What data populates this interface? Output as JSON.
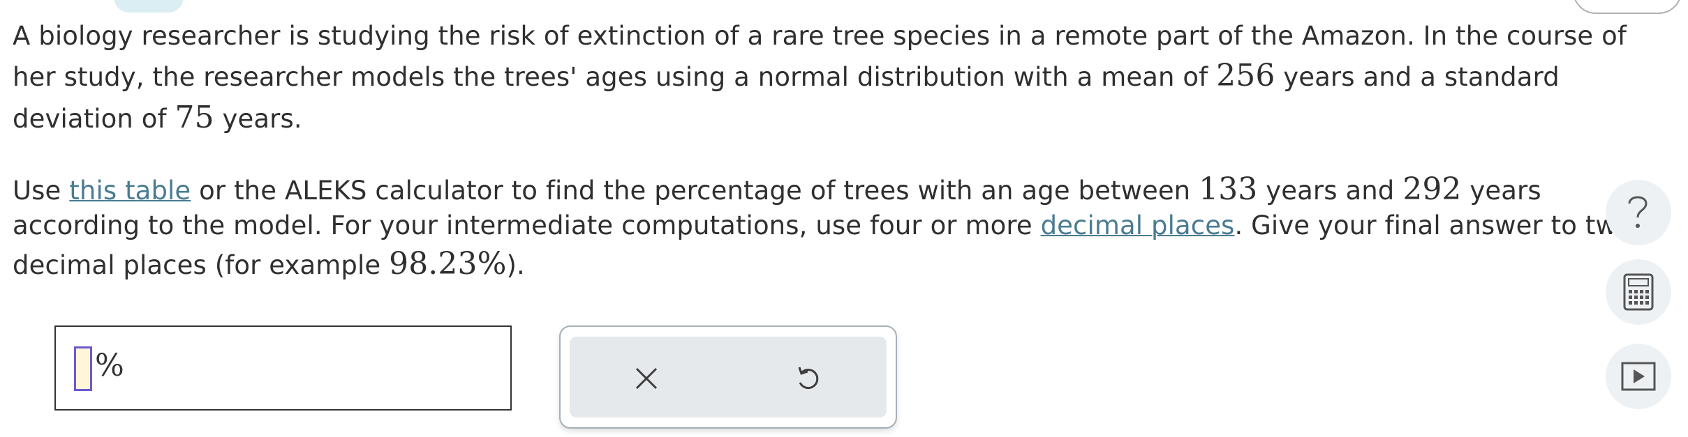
{
  "problem": {
    "p1_line1": "A biology researcher is studying the risk of extinction of a rare tree species in a remote part of the Amazon. In the course of",
    "p1_line2_a": "her study, the researcher models the trees' ages using a normal distribution with a mean of ",
    "mean": "256",
    "p1_line2_b": " years and a standard",
    "p1_line3_a": "deviation of ",
    "sd": "75",
    "p1_line3_b": " years.",
    "p2_line1_a": "Use ",
    "table_link": "this table",
    "p2_line1_b": " or the ALEKS calculator to find the percentage of trees with an age between ",
    "low": "133",
    "p2_line1_c": " years and ",
    "high": "292",
    "p2_line1_d": " years",
    "p2_line2_a": "according to the model. For your intermediate computations, use four or more ",
    "decimal_link": "decimal places",
    "p2_line2_b": ". Give your final answer to two",
    "p2_line3_a": "decimal places (for example ",
    "example": "98.23%",
    "p2_line3_b": ")."
  },
  "answer": {
    "value": "",
    "unit": "%"
  },
  "tools": {
    "clear_icon": "x-icon",
    "undo_icon": "undo-icon"
  },
  "sidebar": {
    "help_icon": "question-icon",
    "calculator_icon": "calculator-icon",
    "video_icon": "play-icon"
  },
  "colors": {
    "link": "#4a7c91",
    "input_border": "#6a5acd",
    "input_fill": "#fff5d9",
    "tools_bg": "#e6e9ec"
  }
}
